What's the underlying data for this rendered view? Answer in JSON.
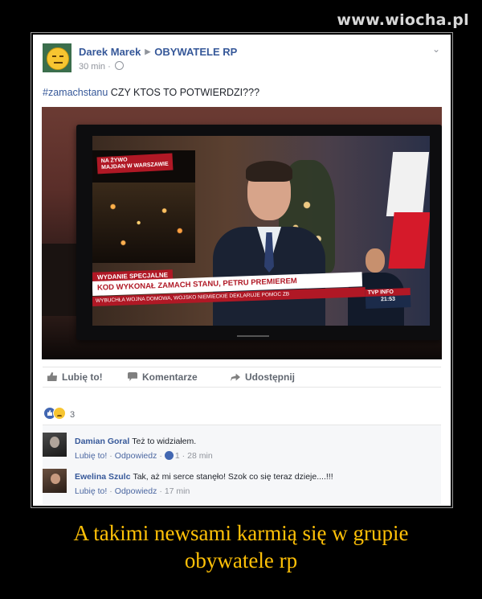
{
  "watermark": "www.wiocha.pl",
  "post": {
    "author": "Darek Marek",
    "group": "OBYWATELE RP",
    "time": "30 min ·",
    "hashtag": "#zamachstanu",
    "text": " CZY KTOS TO POTWIERDZI???"
  },
  "tv": {
    "live_tag": "NA ŻYWO\nMAJDAN W WARSZAWIE",
    "special": "WYDANIE SPECJALNE",
    "headline": "KOD WYKONAŁ ZAMACH STANU, PETRU PREMIEREM",
    "subline": "WYBUCHŁA WOJNA DOMOWA, WOJSKO NIEMIECKIE DEKLARUJE POMOC ZB",
    "channel": "TVP INFO",
    "clock": "21:53"
  },
  "actions": {
    "like": "Lubię to!",
    "comment": "Komentarze",
    "share": "Udostępnij"
  },
  "reactions": {
    "count": "3"
  },
  "comments": [
    {
      "name": "Damian Goral",
      "text": "Też to widziałem.",
      "like": "Lubię to!",
      "reply": "Odpowiedz",
      "likes": "1",
      "time": "28 min"
    },
    {
      "name": "Ewelina Szulc",
      "text": "Tak, aż mi serce stanęło! Szok co się teraz dzieje....!!!",
      "like": "Lubię to!",
      "reply": "Odpowiedz",
      "time": "17 min"
    }
  ],
  "caption": {
    "line1": "A takimi newsami karmią się w grupie",
    "line2": "obywatele rp"
  }
}
